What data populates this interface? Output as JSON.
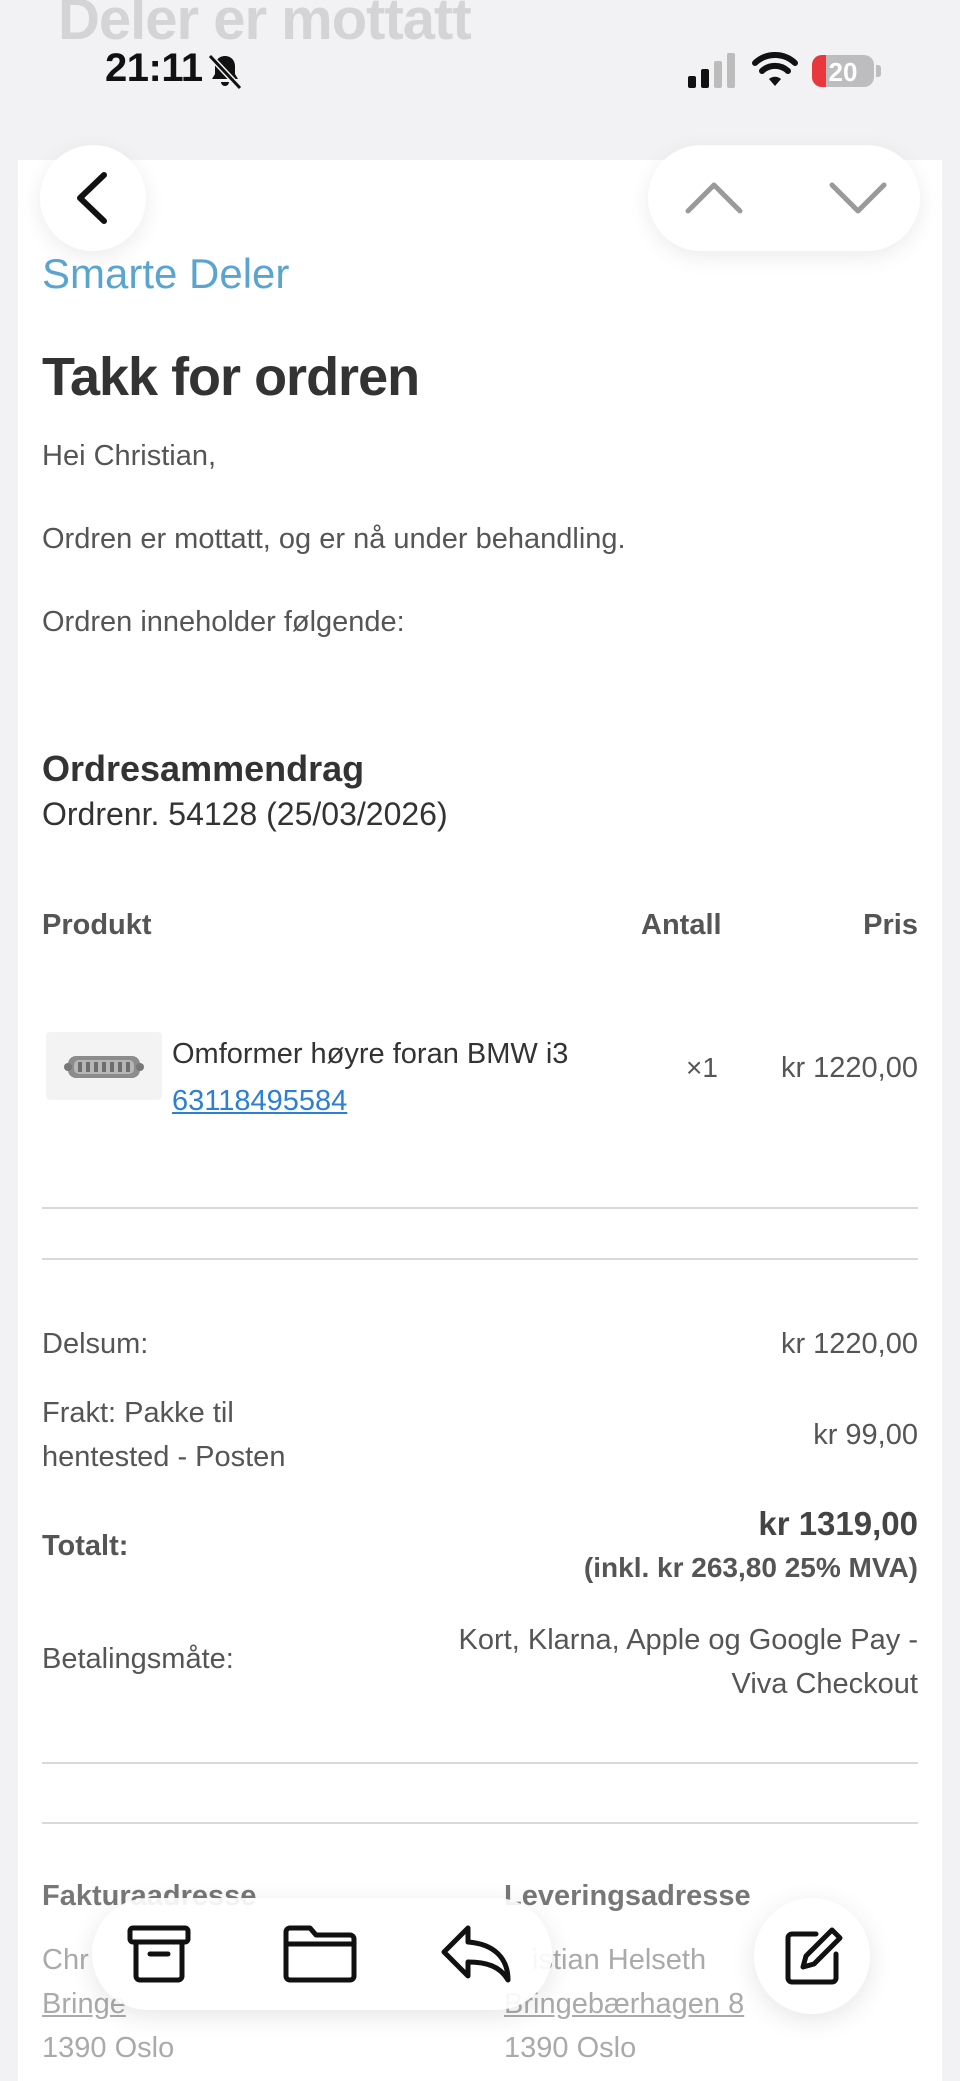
{
  "email": {
    "subject_ghost": "Deler er mottatt",
    "sender_name": "Smarte Deler",
    "heading": "Takk for ordren",
    "greeting": "Hei Christian,",
    "body_line1": "Ordren er mottatt, og er nå under behandling.",
    "body_line2": "Ordren inneholder følgende:"
  },
  "status_bar": {
    "time": "21:11",
    "battery_percent": "20",
    "icons": [
      "bell-slash-icon",
      "cellular-signal-icon",
      "wifi-icon",
      "battery-icon"
    ]
  },
  "nav": {
    "icons": [
      "chevron-left-icon",
      "chevron-up-icon",
      "chevron-down-icon"
    ]
  },
  "order": {
    "summary_title": "Ordresammendrag",
    "order_number_line": "Ordrenr. 54128 (25/03/2026)",
    "headers": {
      "product": "Produkt",
      "quantity": "Antall",
      "price": "Pris"
    },
    "items": [
      {
        "name": "Omformer høyre foran BMW i3",
        "sku": "63118495584",
        "quantity": "×1",
        "price": "kr 1220,00"
      }
    ]
  },
  "totals": {
    "subtotal_label": "Delsum:",
    "subtotal_value": "kr 1220,00",
    "shipping_label_line1": "Frakt: Pakke til",
    "shipping_label_line2": "hentested - Posten",
    "shipping_value": "kr 99,00",
    "total_label": "Totalt:",
    "total_value": "kr 1319,00",
    "total_vat": "(inkl. kr 263,80 25% MVA)",
    "payment_label": "Betalingsmåte:",
    "payment_value_line1": "Kort, Klarna, Apple og Google Pay -",
    "payment_value_line2": "Viva Checkout"
  },
  "addresses": {
    "billing_title": "Fakturaadresse",
    "billing_line1": "Chr",
    "billing_line2": "Bringe",
    "billing_line3": "1390 Oslo",
    "shipping_title": "Leveringsadresse",
    "shipping_line1": "istian Helseth",
    "shipping_line2": "Bringebærhagen 8",
    "shipping_line3": "1390 Oslo"
  },
  "toolbar": {
    "icons": [
      "archive-icon",
      "folder-icon",
      "reply-icon",
      "compose-icon"
    ]
  },
  "colors": {
    "brand": "#5aa5cf",
    "link": "#2d7fd4",
    "battery_low": "#e8373d"
  }
}
